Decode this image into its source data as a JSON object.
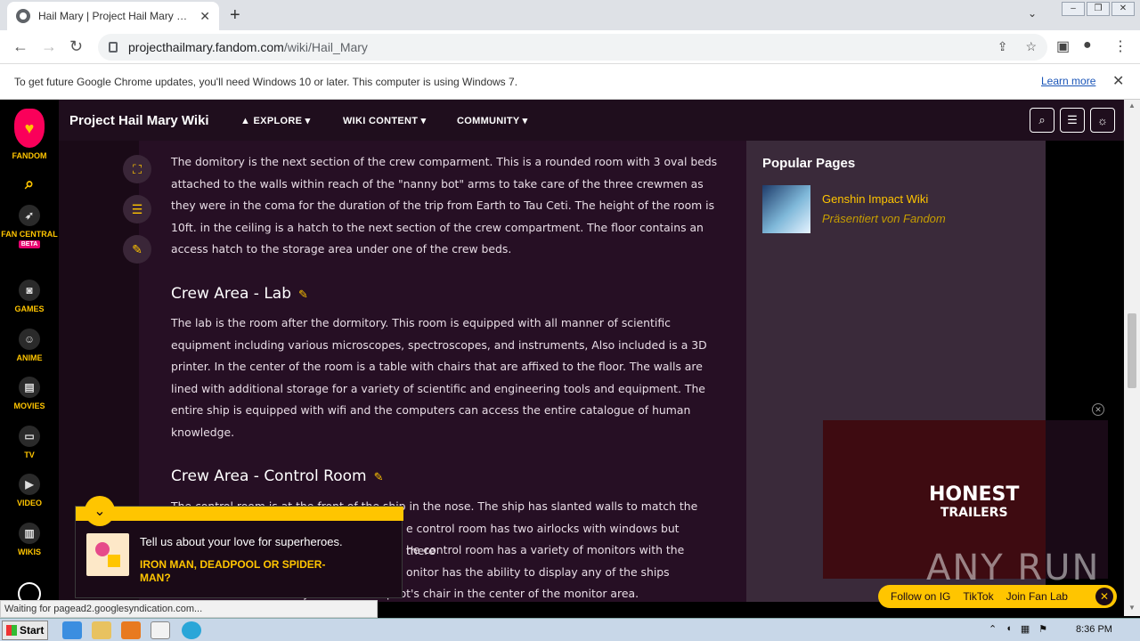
{
  "browser": {
    "tab_title": "Hail Mary | Project Hail Mary Wiki | F",
    "url_host": "projecthailmary.fandom.com",
    "url_path": "/wiki/Hail_Mary"
  },
  "infobar": {
    "message": "To get future Google Chrome updates, you'll need Windows 10 or later. This computer is using Windows 7.",
    "learn_more": "Learn more"
  },
  "rail": {
    "fandom": "FANDOM",
    "fan_central": "FAN CENTRAL",
    "beta": "BETA",
    "games": "GAMES",
    "anime": "ANIME",
    "movies": "MOVIES",
    "tv": "TV",
    "video": "VIDEO",
    "wikis": "WIKIS"
  },
  "wiki": {
    "title": "Project Hail Mary Wiki",
    "nav": [
      "EXPLORE",
      "WIKI CONTENT",
      "COMMUNITY"
    ]
  },
  "article": {
    "p1": "The domitory is the next section of the crew comparment. This is a rounded room with 3 oval beds attached to the walls within reach of the \"nanny bot\" arms to take care of the three crewmen as they were in the coma for the duration of the trip from Earth to Tau Ceti. The height of the room is 10ft. in the ceiling is a hatch to the next section of the crew compartment. The floor contains an access hatch to the storage area under one of the crew beds.",
    "h2": "Crew Area - Lab",
    "p2": "The lab is the room after the dormitory. This room is equipped with all manner of scientific equipment including various microscopes, spectroscopes, and instruments, Also included is a 3D printer. In the center of the room is a table with chairs that are affixed to the floor. The walls are lined with additional storage for a variety of scientific and engineering tools and equipment. The entire ship is equipped with wifi and the computers can access the entire catalogue of human knowledge.",
    "h3": "Crew Area - Control Room",
    "p3_l1": "The control room is at the front of the ship in the nose. The ship has slanted walls to match the",
    "p3_l2": "e control room has two airlocks with windows but there",
    "p3_l3": "he control room has a variety of monitors with the",
    "p3_l4": "onitor has the ability to display any of the ships",
    "p3_l5": "functions for redundancy. There is one pilot's chair in the center of the monitor area."
  },
  "sidebar": {
    "title": "Popular Pages",
    "item_name": "Genshin Impact Wiki",
    "item_sub": "Präsentiert von Fandom"
  },
  "video": {
    "line1": "HONEST",
    "line2": "TRAILERS",
    "follow_ig": "Follow on IG",
    "tiktok": "TikTok",
    "fan_lab": "Join Fan Lab"
  },
  "watermark": "ANY RUN",
  "survey": {
    "question": "Tell us about your love for superheroes.",
    "answer": "IRON MAN, DEADPOOL OR SPIDER-MAN?"
  },
  "status": "Waiting for pagead2.googlesyndication.com...",
  "taskbar": {
    "start": "Start",
    "time": "8:36 PM"
  }
}
